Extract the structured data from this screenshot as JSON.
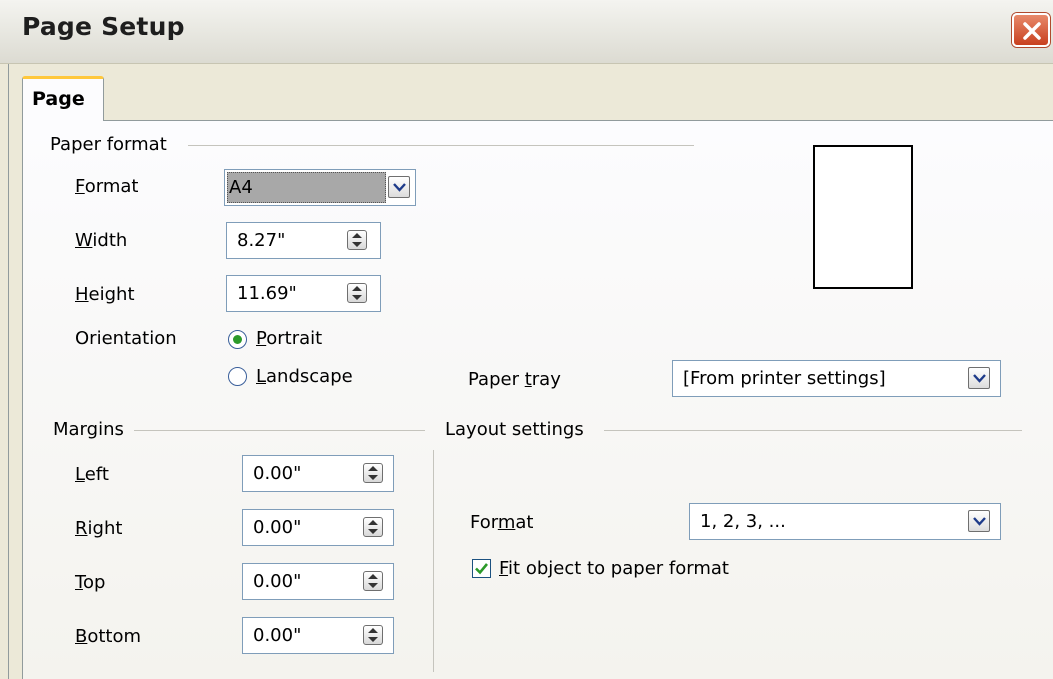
{
  "window": {
    "title": "Page Setup"
  },
  "tabs": [
    {
      "label": "Page"
    }
  ],
  "paper_format": {
    "heading": "Paper format",
    "format_label": "Format",
    "format_value": "A4",
    "width_label": "Width",
    "width_value": "8.27\"",
    "height_label": "Height",
    "height_value": "11.69\"",
    "orientation_label": "Orientation",
    "portrait_label": "Portrait",
    "landscape_label": "Landscape",
    "orientation_selected": "Portrait",
    "paper_tray_label": "Paper tray",
    "paper_tray_value": "[From printer settings]"
  },
  "margins": {
    "heading": "Margins",
    "left_label": "Left",
    "left_value": "0.00\"",
    "right_label": "Right",
    "right_value": "0.00\"",
    "top_label": "Top",
    "top_value": "0.00\"",
    "bottom_label": "Bottom",
    "bottom_value": "0.00\""
  },
  "layout_settings": {
    "heading": "Layout settings",
    "format_label": "Format",
    "format_value": "1, 2, 3, ...",
    "fit_object_label": "Fit object to paper format",
    "fit_object_checked": true
  },
  "colors": {
    "accent_tab": "#ffc83c",
    "close_button": "#c8401f",
    "checkmark": "#2c9a2a"
  }
}
